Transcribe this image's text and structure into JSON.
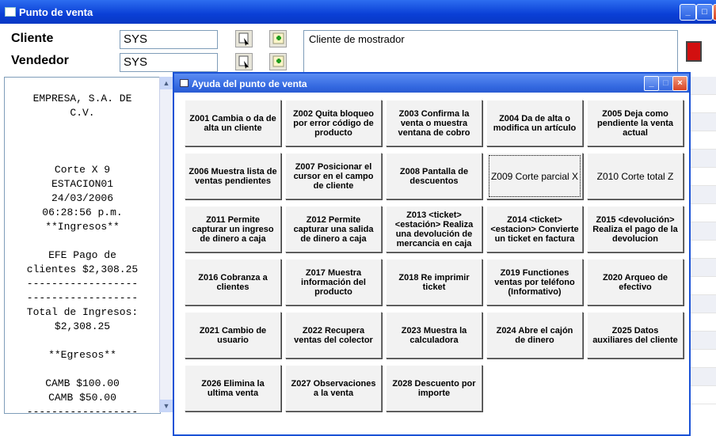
{
  "window": {
    "title": "Punto de venta"
  },
  "header": {
    "cliente_label": "Cliente",
    "cliente_value": "SYS",
    "vendedor_label": "Vendedor",
    "vendedor_value": "SYS",
    "cliente_desc": "Cliente de mostrador"
  },
  "ticket": {
    "lines": [
      "",
      "EMPRESA, S.A. DE",
      "C.V.",
      "",
      "",
      "",
      "Corte X 9",
      "ESTACION01",
      "24/03/2006",
      "06:28:56 p.m.",
      "**Ingresos**",
      "",
      "EFE Pago de",
      "clientes $2,308.25",
      "------------------",
      "------------------",
      "Total de Ingresos:",
      "$2,308.25",
      "",
      "**Egresos**",
      "",
      "CAMB $100.00",
      "CAMB $50.00",
      "------------------",
      "------------------"
    ]
  },
  "dialog": {
    "title": "Ayuda del punto de venta",
    "keys": [
      "Z001 Cambia o da de alta un cliente",
      "Z002 Quita bloqueo por error código de producto",
      "Z003 Confirma la venta o muestra ventana de cobro",
      "Z004 Da de alta o modifica un artículo",
      "Z005 Deja como pendiente la venta actual",
      "Z006 Muestra lista de ventas pendientes",
      "Z007 Posicionar el cursor en el campo de cliente",
      "Z008 Pantalla de descuentos",
      "Z009 Corte parcial X",
      "Z010 Corte total Z",
      "Z011 Permite capturar un ingreso de dinero a caja",
      "Z012 Permite capturar una salida de dinero a caja",
      "Z013 <ticket> <estación> Realiza una devolución de mercancia en caja",
      "Z014 <ticket> <estacion> Convierte un ticket en factura",
      "Z015 <devolución> Realiza el pago de la devolucion",
      "Z016 Cobranza a clientes",
      "Z017 Muestra información del producto",
      "Z018 Re imprimir ticket",
      "Z019 Functiones ventas por teléfono (Informativo)",
      "Z020 Arqueo de efectivo",
      "Z021 Cambio de usuario",
      "Z022 Recupera ventas del colector",
      "Z023 Muestra la calculadora",
      "Z024 Abre el cajón de dinero",
      "Z025 Datos auxiliares del cliente",
      "Z026 Elimina la ultima venta",
      "Z027 Observaciones a la venta",
      "Z028 Descuento por importe"
    ],
    "selected_index": 8
  },
  "colors": {
    "titlebar": "#0a3fd6",
    "dialog_title": "#3368e0",
    "close": "#d94424"
  },
  "icons": [
    "app-window-icon",
    "search-select-icon",
    "add-icon",
    "exit-icon",
    "scroll-up-icon",
    "scroll-down-icon"
  ]
}
